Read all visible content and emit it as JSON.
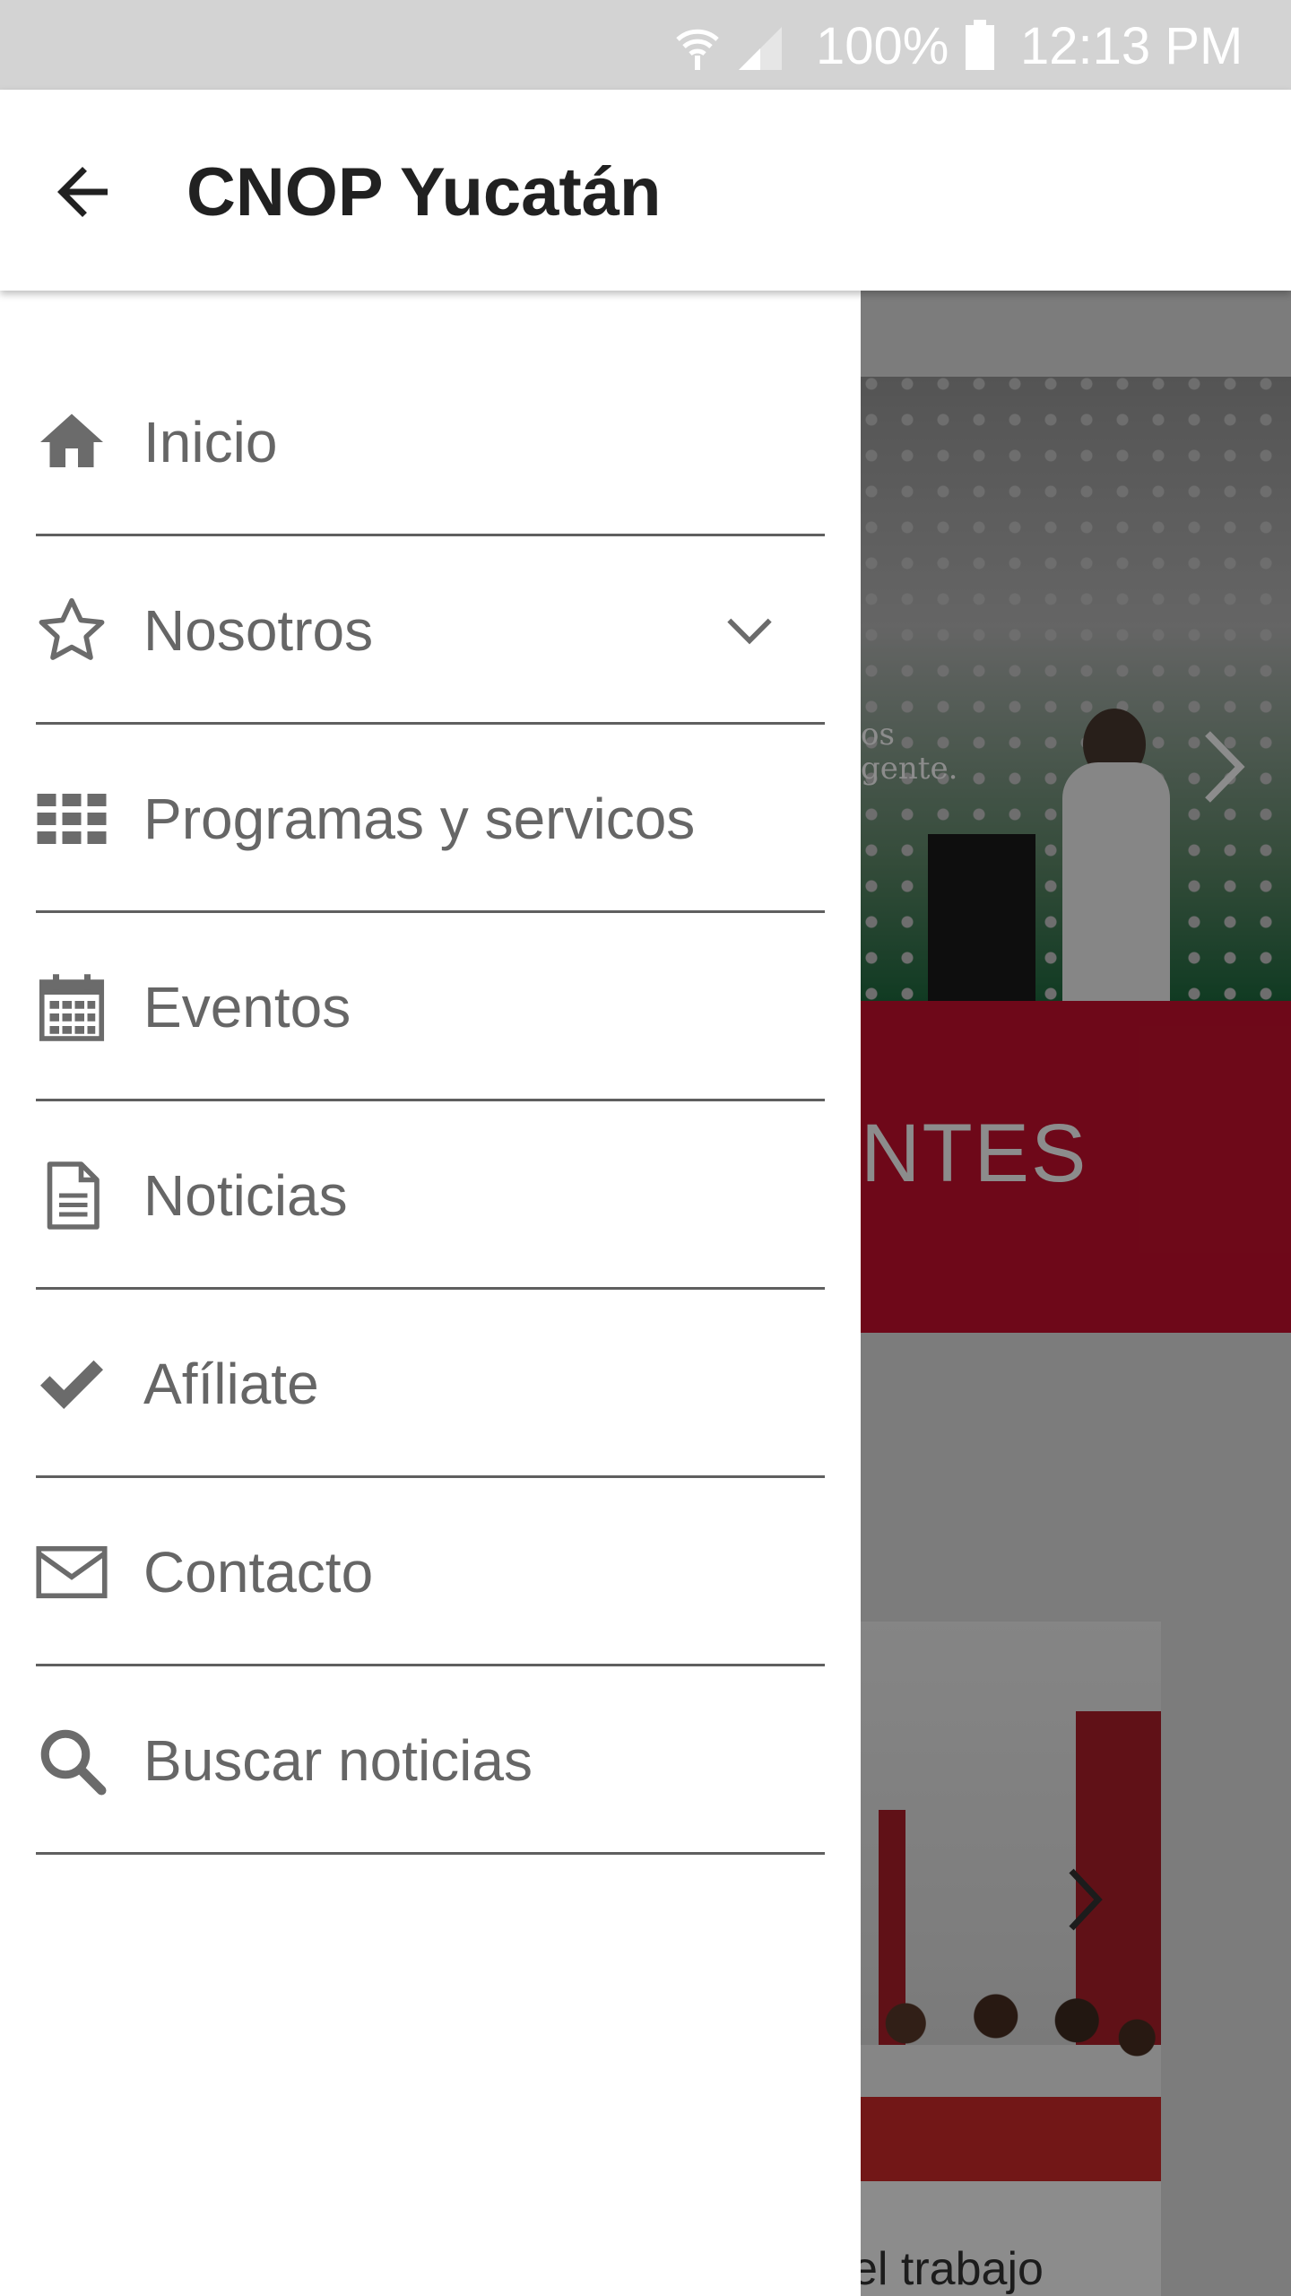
{
  "status_bar": {
    "battery_percent": "100%",
    "time": "12:13 PM",
    "icons": [
      "wifi-icon",
      "cell-signal-icon",
      "battery-icon"
    ]
  },
  "app_bar": {
    "title": "CNOP Yucatán",
    "back_icon": "arrow-back-icon"
  },
  "drawer": {
    "items": [
      {
        "label": "Inicio",
        "icon": "home-icon"
      },
      {
        "label": "Nosotros",
        "icon": "star-outline-icon",
        "expandable": true
      },
      {
        "label": "Programas y servicos",
        "icon": "grid-icon"
      },
      {
        "label": "Eventos",
        "icon": "calendar-icon"
      },
      {
        "label": "Noticias",
        "icon": "document-icon"
      },
      {
        "label": "Afíliate",
        "icon": "checkmark-icon"
      },
      {
        "label": "Contacto",
        "icon": "envelope-icon"
      },
      {
        "label": "Buscar noticias",
        "icon": "search-icon"
      }
    ]
  },
  "background": {
    "hero_tagline": [
      "os",
      "gente."
    ],
    "band_text": "NTES",
    "card_caption": "el trabajo"
  },
  "colors": {
    "status_bar": "#d3d3d3",
    "band_red": "#c8102e",
    "drawer_text": "#666666",
    "icon_gray": "#6b6b6b"
  }
}
